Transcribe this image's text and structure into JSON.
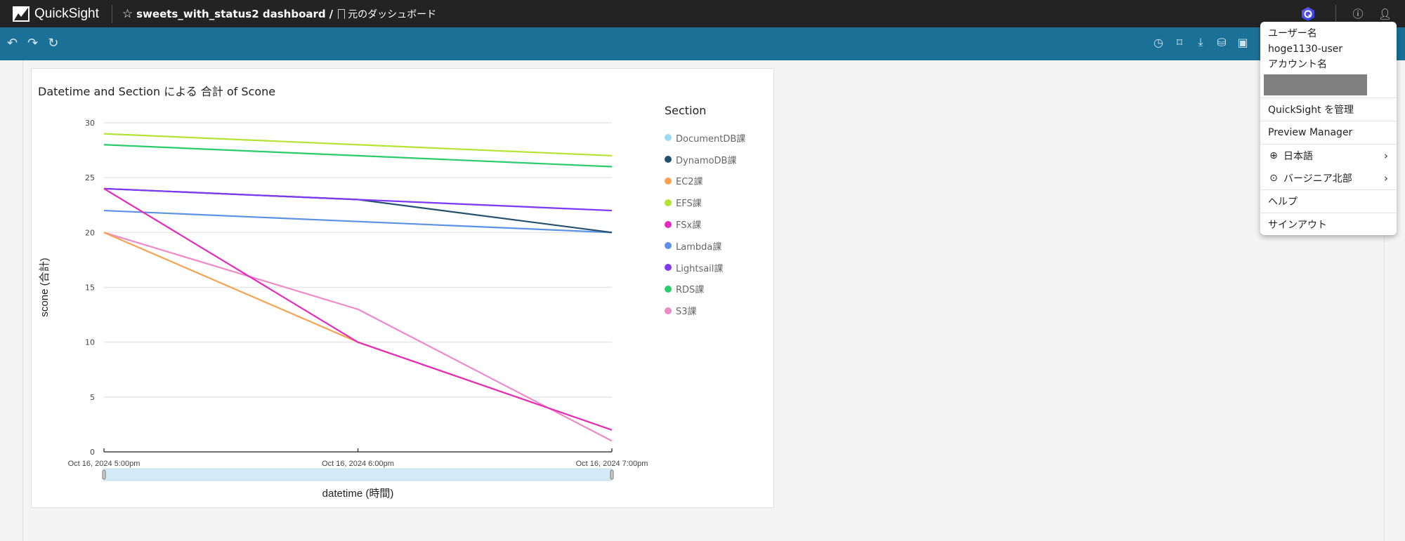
{
  "app": {
    "name": "QuickSight",
    "breadcrumb": {
      "dashboard": "sweets_with_status2 dashboard",
      "separator": "/",
      "sheet": "元のダッシュボード"
    }
  },
  "toolbar": {
    "left_icons": [
      "undo-icon",
      "redo-icon",
      "reset-icon"
    ],
    "right_icons": [
      "schedule-icon",
      "bookmark-icon",
      "export-icon",
      "dataset-icon",
      "save-icon",
      "share-icon"
    ]
  },
  "top_icons": [
    "q-assistant-icon",
    "help-icon",
    "user-icon"
  ],
  "user_menu": {
    "username_label": "ユーザー名",
    "username": "hoge1130-user",
    "account_label": "アカウント名",
    "items": [
      {
        "label": "QuickSight を管理"
      },
      {
        "label": "Preview Manager"
      },
      {
        "label": "日本語",
        "icon": "globe-icon",
        "submenu": true
      },
      {
        "label": "バージニア北部",
        "icon": "location-icon",
        "submenu": true
      },
      {
        "label": "ヘルプ"
      },
      {
        "label": "サインアウト"
      }
    ]
  },
  "chart_data": {
    "type": "line",
    "title": "Datetime and Section による 合計 of Scone",
    "xlabel": "datetime (時間)",
    "ylabel": "scone (合計)",
    "x": [
      "Oct 16, 2024 5:00pm",
      "Oct 16, 2024 6:00pm",
      "Oct 16, 2024 7:00pm"
    ],
    "ylim": [
      0,
      30
    ],
    "yticks": [
      0,
      5,
      10,
      15,
      20,
      25,
      30
    ],
    "grid": true,
    "legend_title": "Section",
    "legend_position": "right",
    "series": [
      {
        "name": "DocumentDB課",
        "color": "#9dd9f3",
        "values": [
          24,
          23,
          22
        ]
      },
      {
        "name": "DynamoDB課",
        "color": "#24506f",
        "values": [
          24,
          23,
          20
        ]
      },
      {
        "name": "EC2課",
        "color": "#f7a350",
        "values": [
          20,
          10,
          2
        ]
      },
      {
        "name": "EFS課",
        "color": "#b5e435",
        "values": [
          29,
          28,
          27
        ]
      },
      {
        "name": "FSx課",
        "color": "#e52bba",
        "values": [
          24,
          10,
          2
        ]
      },
      {
        "name": "Lambda課",
        "color": "#5b92e5",
        "values": [
          22,
          21,
          20
        ]
      },
      {
        "name": "Lightsail課",
        "color": "#8138f5",
        "values": [
          24,
          23,
          22
        ]
      },
      {
        "name": "RDS課",
        "color": "#2bcc6b",
        "values": [
          28,
          27,
          26
        ]
      },
      {
        "name": "S3課",
        "color": "#ef8ac8",
        "values": [
          20,
          13,
          1
        ]
      }
    ]
  }
}
